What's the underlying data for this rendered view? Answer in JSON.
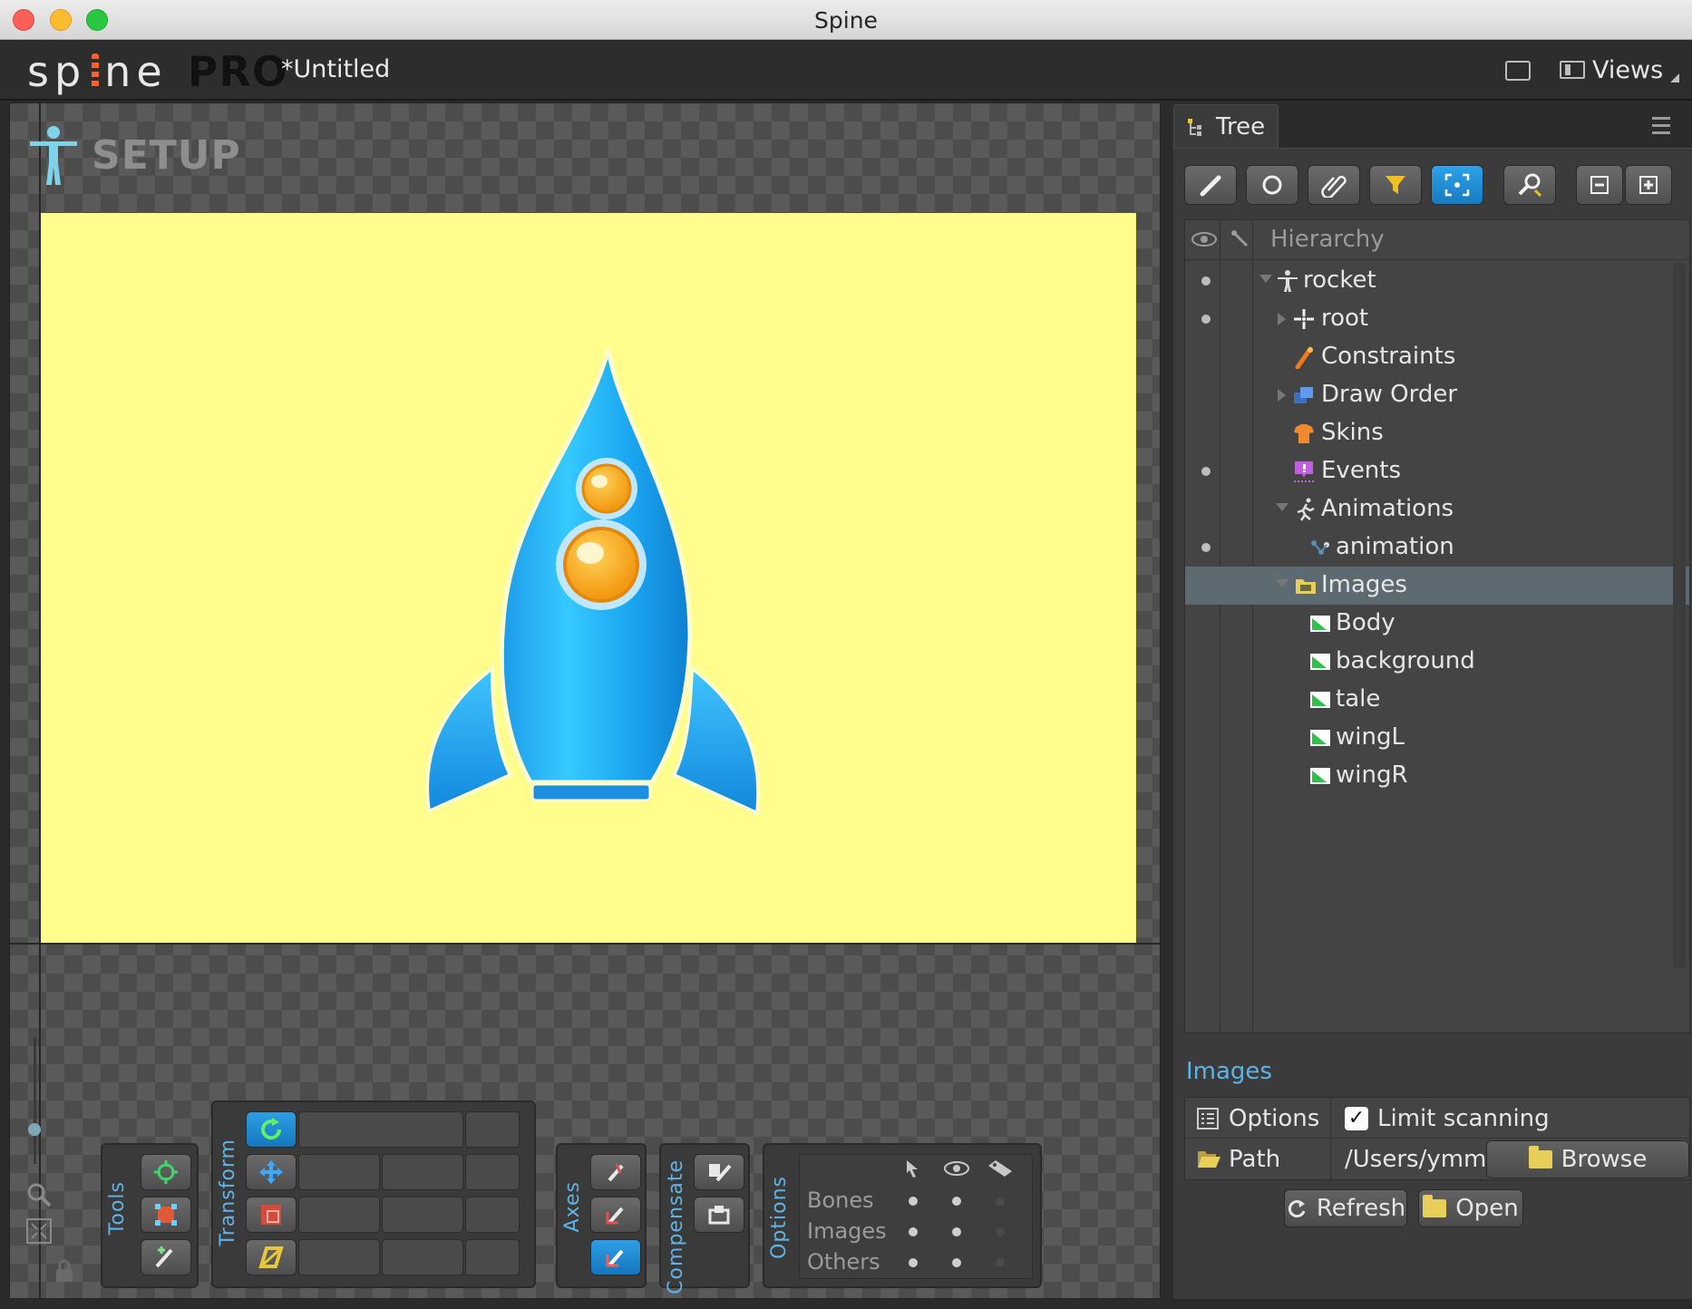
{
  "window": {
    "title": "Spine"
  },
  "app": {
    "logo_text": "spine",
    "edition": "PRO",
    "doc_title": "*Untitled",
    "views_label": "Views"
  },
  "viewport": {
    "mode_label": "SETUP",
    "tools_label": "Tools",
    "transform_label": "Transform",
    "axes_label": "Axes",
    "compensate_label": "Compensate",
    "options_label": "Options",
    "options_rows": [
      "Bones",
      "Images",
      "Others"
    ]
  },
  "tree": {
    "tab_label": "Tree",
    "hierarchy_label": "Hierarchy",
    "items": [
      {
        "label": "rocket",
        "icon": "skeleton-icon",
        "level": 0,
        "expanded": true,
        "visible": true
      },
      {
        "label": "root",
        "icon": "bone-icon",
        "level": 1,
        "collapsed": true,
        "visible": true
      },
      {
        "label": "Constraints",
        "icon": "constraints-icon",
        "level": 1
      },
      {
        "label": "Draw Order",
        "icon": "draw-order-icon",
        "level": 1,
        "collapsed": true
      },
      {
        "label": "Skins",
        "icon": "skins-icon",
        "level": 1
      },
      {
        "label": "Events",
        "icon": "events-icon",
        "level": 1,
        "visible": true
      },
      {
        "label": "Animations",
        "icon": "animations-icon",
        "level": 1,
        "expanded": true
      },
      {
        "label": "animation",
        "icon": "animation-icon",
        "level": 2,
        "visible": true
      },
      {
        "label": "Images",
        "icon": "folder-icon",
        "level": 1,
        "expanded": true,
        "selected": true
      },
      {
        "label": "Body",
        "icon": "image-icon",
        "level": 2
      },
      {
        "label": "background",
        "icon": "image-icon",
        "level": 2
      },
      {
        "label": "tale",
        "icon": "image-icon",
        "level": 2
      },
      {
        "label": "wingL",
        "icon": "image-icon",
        "level": 2
      },
      {
        "label": "wingR",
        "icon": "image-icon",
        "level": 2
      }
    ]
  },
  "images_panel": {
    "title": "Images",
    "options_label": "Options",
    "limit_scanning_label": "Limit scanning",
    "limit_scanning_checked": true,
    "path_label": "Path",
    "path_value": "/Users/ymmtny/",
    "browse_label": "Browse",
    "refresh_label": "Refresh",
    "open_label": "Open"
  },
  "colors": {
    "accent": "#5fb3e6",
    "artboard": "#fffe8c",
    "selected_row": "#5d6a72"
  }
}
